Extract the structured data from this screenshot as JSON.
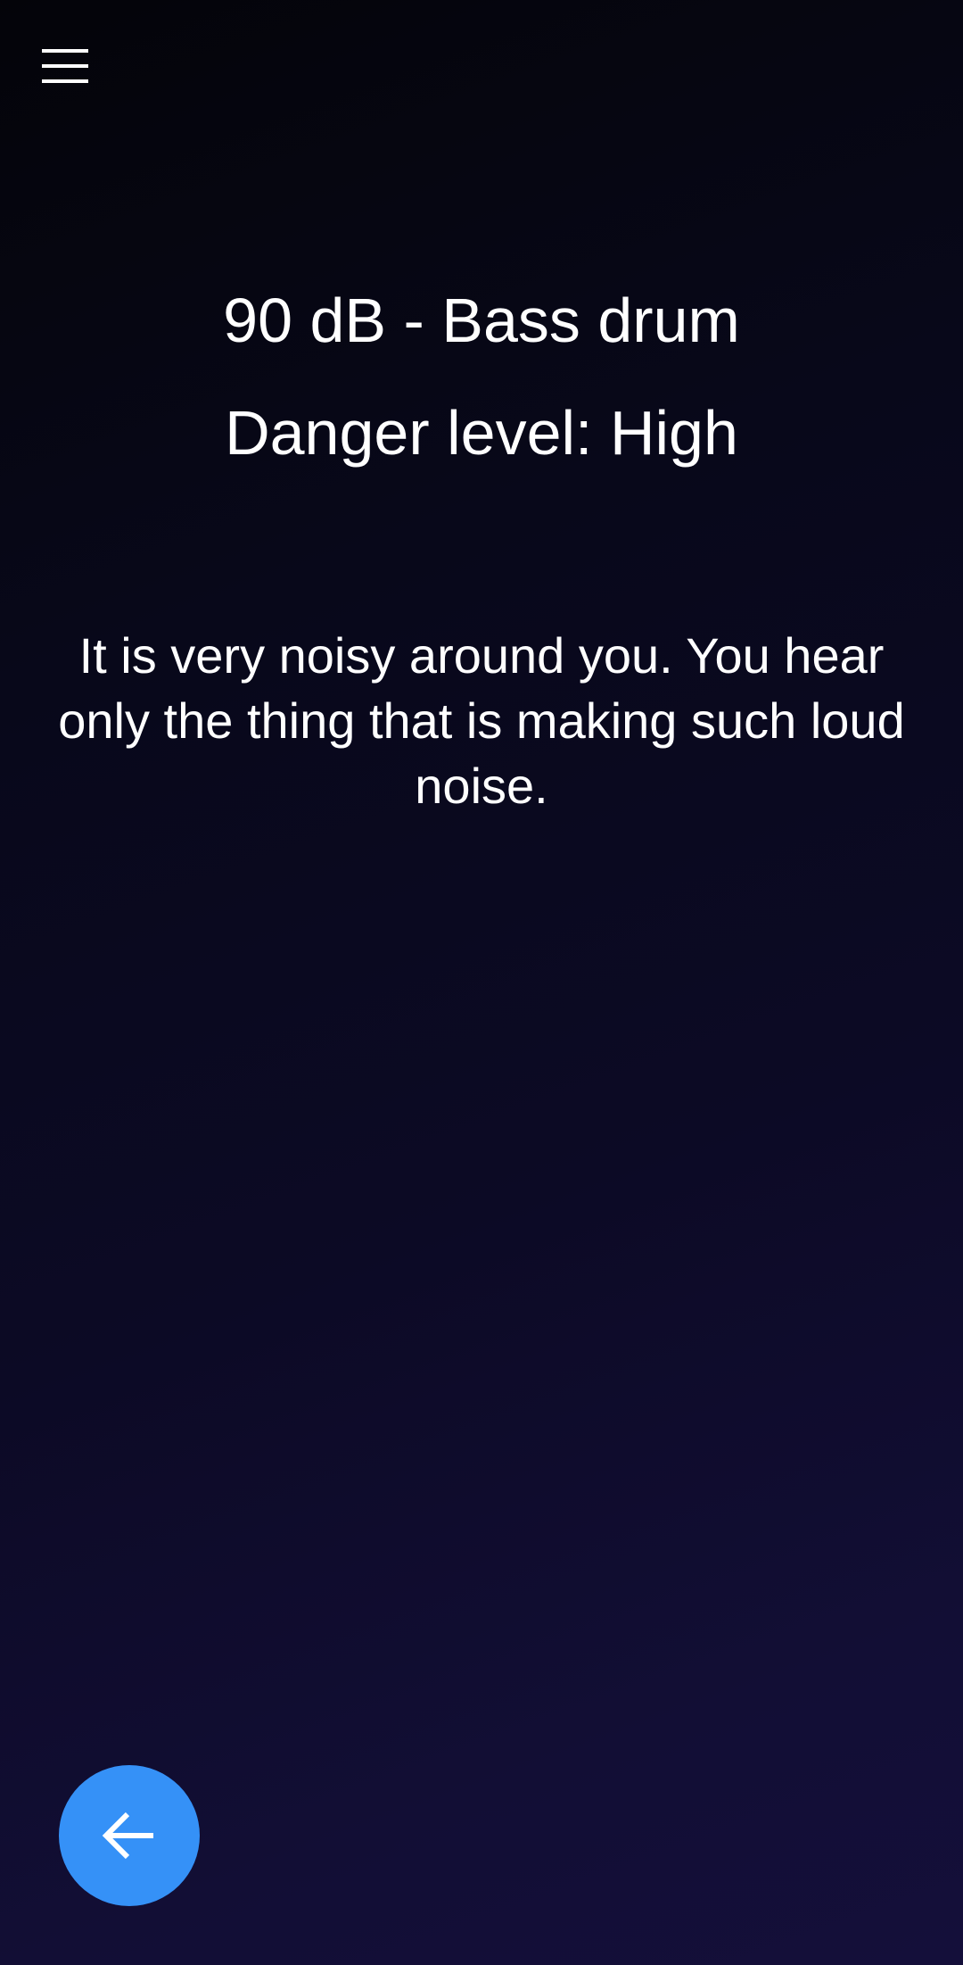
{
  "header": {
    "menu_icon": "menu-icon"
  },
  "main": {
    "title": "90 dB - Bass drum",
    "danger_level": "Danger level: High",
    "description": "It is very noisy around you. You hear only the thing that is making such loud noise."
  },
  "fab": {
    "icon": "arrow-back-icon",
    "color": "#3591f7"
  },
  "colors": {
    "background_top": "#040409",
    "background_bottom": "#140f3a",
    "text": "#ffffff"
  }
}
